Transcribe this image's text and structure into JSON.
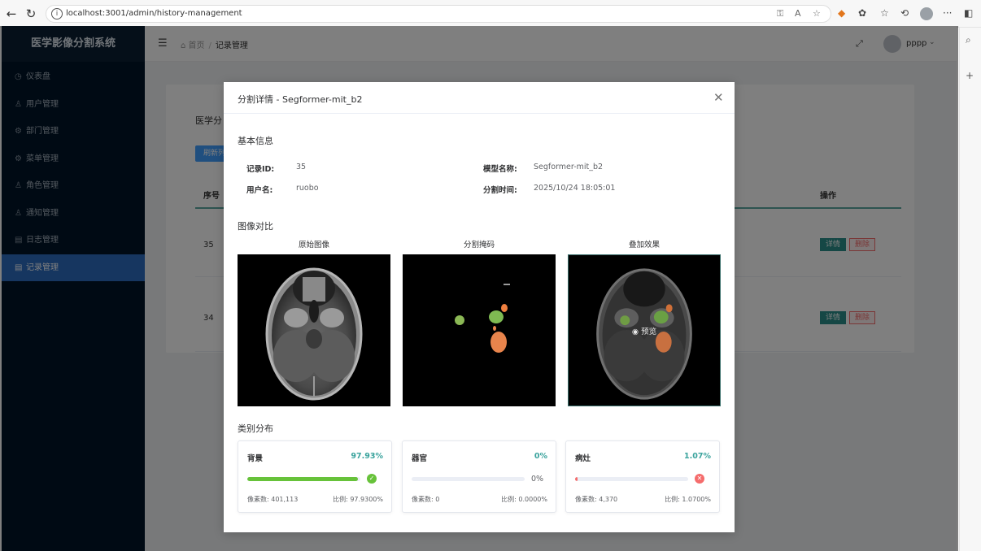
{
  "browser": {
    "url": "localhost:3001/admin/history-management"
  },
  "app": {
    "brand": "医学影像分割系统",
    "menu": [
      {
        "label": "仪表盘",
        "icon": "dashboard-icon"
      },
      {
        "label": "用户管理",
        "icon": "user-icon"
      },
      {
        "label": "部门管理",
        "icon": "gear-icon"
      },
      {
        "label": "菜单管理",
        "icon": "gear-icon"
      },
      {
        "label": "角色管理",
        "icon": "user-icon"
      },
      {
        "label": "通知管理",
        "icon": "user-icon"
      },
      {
        "label": "日志管理",
        "icon": "document-icon"
      },
      {
        "label": "记录管理",
        "icon": "document-icon",
        "active": true
      }
    ],
    "breadcrumb": {
      "home": "首页",
      "current": "记录管理"
    },
    "user": "pppp"
  },
  "page": {
    "card_title": "医学分",
    "refresh_button": "刷新列",
    "col_index": "序号",
    "col_action": "操作",
    "rows": [
      {
        "index": "35",
        "detail": "详情",
        "delete": "删除"
      },
      {
        "index": "34",
        "detail": "详情",
        "delete": "删除"
      }
    ]
  },
  "modal": {
    "title": "分割详情 - Segformer-mit_b2",
    "section_basic": "基本信息",
    "record_id_label": "记录ID:",
    "record_id": "35",
    "username_label": "用户名:",
    "username": "ruobo",
    "model_label": "模型名称:",
    "model": "Segformer-mit_b2",
    "time_label": "分割时间:",
    "time": "2025/10/24 18:05:01",
    "section_images": "图像对比",
    "img_original": "原始图像",
    "img_mask": "分割掩码",
    "img_overlay": "叠加效果",
    "preview": "预览",
    "section_classes": "类别分布",
    "classes": [
      {
        "name": "背景",
        "percent": "97.93%",
        "fill": 0.9793,
        "status": "success",
        "progress_text": "",
        "pixels": "像素数: 401,113",
        "ratio": "比例: 97.9300%",
        "color": "#67c23a"
      },
      {
        "name": "器官",
        "percent": "0%",
        "fill": 0,
        "status": "none",
        "progress_text": "0%",
        "pixels": "像素数: 0",
        "ratio": "比例: 0.0000%",
        "color": "#67c23a"
      },
      {
        "name": "病灶",
        "percent": "1.07%",
        "fill": 0.0107,
        "status": "exception",
        "progress_text": "",
        "pixels": "像素数: 4,370",
        "ratio": "比例: 1.0700%",
        "color": "#f56c6c"
      }
    ]
  },
  "colors": {
    "sidebar_bg": "#001529",
    "accent": "#2b8e8a",
    "percent": "#3aa39d"
  }
}
